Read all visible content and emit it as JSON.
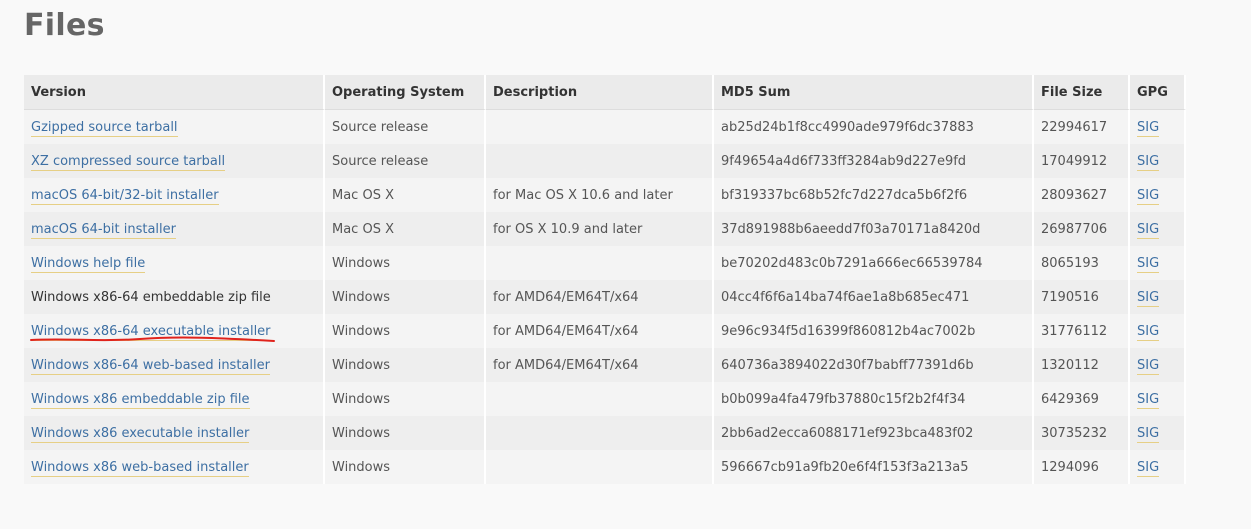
{
  "page": {
    "title": "Files"
  },
  "table": {
    "headers": {
      "version": "Version",
      "os": "Operating System",
      "description": "Description",
      "md5": "MD5 Sum",
      "size": "File Size",
      "gpg": "GPG"
    },
    "rows": [
      {
        "version": "Gzipped source tarball",
        "version_is_link": true,
        "os": "Source release",
        "description": "",
        "md5": "ab25d24b1f8cc4990ade979f6dc37883",
        "size": "22994617",
        "gpg": "SIG"
      },
      {
        "version": "XZ compressed source tarball",
        "version_is_link": true,
        "os": "Source release",
        "description": "",
        "md5": "9f49654a4d6f733ff3284ab9d227e9fd",
        "size": "17049912",
        "gpg": "SIG"
      },
      {
        "version": "macOS 64-bit/32-bit installer",
        "version_is_link": true,
        "os": "Mac OS X",
        "description": "for Mac OS X 10.6 and later",
        "md5": "bf319337bc68b52fc7d227dca5b6f2f6",
        "size": "28093627",
        "gpg": "SIG"
      },
      {
        "version": "macOS 64-bit installer",
        "version_is_link": true,
        "os": "Mac OS X",
        "description": "for OS X 10.9 and later",
        "md5": "37d891988b6aeedd7f03a70171a8420d",
        "size": "26987706",
        "gpg": "SIG"
      },
      {
        "version": "Windows help file",
        "version_is_link": true,
        "os": "Windows",
        "description": "",
        "md5": "be70202d483c0b7291a666ec66539784",
        "size": "8065193",
        "gpg": "SIG"
      },
      {
        "version": "Windows x86-64 embeddable zip file",
        "version_is_link": false,
        "os": "Windows",
        "description": "for AMD64/EM64T/x64",
        "md5": "04cc4f6f6a14ba74f6ae1a8b685ec471",
        "size": "7190516",
        "gpg": "SIG"
      },
      {
        "version": "Windows x86-64 executable installer",
        "version_is_link": true,
        "os": "Windows",
        "description": "for AMD64/EM64T/x64",
        "md5": "9e96c934f5d16399f860812b4ac7002b",
        "size": "31776112",
        "gpg": "SIG",
        "annotated": true
      },
      {
        "version": "Windows x86-64 web-based installer",
        "version_is_link": true,
        "os": "Windows",
        "description": "for AMD64/EM64T/x64",
        "md5": "640736a3894022d30f7babff77391d6b",
        "size": "1320112",
        "gpg": "SIG"
      },
      {
        "version": "Windows x86 embeddable zip file",
        "version_is_link": true,
        "os": "Windows",
        "description": "",
        "md5": "b0b099a4fa479fb37880c15f2b2f4f34",
        "size": "6429369",
        "gpg": "SIG"
      },
      {
        "version": "Windows x86 executable installer",
        "version_is_link": true,
        "os": "Windows",
        "description": "",
        "md5": "2bb6ad2ecca6088171ef923bca483f02",
        "size": "30735232",
        "gpg": "SIG"
      },
      {
        "version": "Windows x86 web-based installer",
        "version_is_link": true,
        "os": "Windows",
        "description": "",
        "md5": "596667cb91a9fb20e6f4f153f3a213a5",
        "size": "1294096",
        "gpg": "SIG"
      }
    ]
  },
  "colors": {
    "link": "#3d6fa3",
    "link_underline": "#e6cf85",
    "annotation": "#e0231c"
  }
}
